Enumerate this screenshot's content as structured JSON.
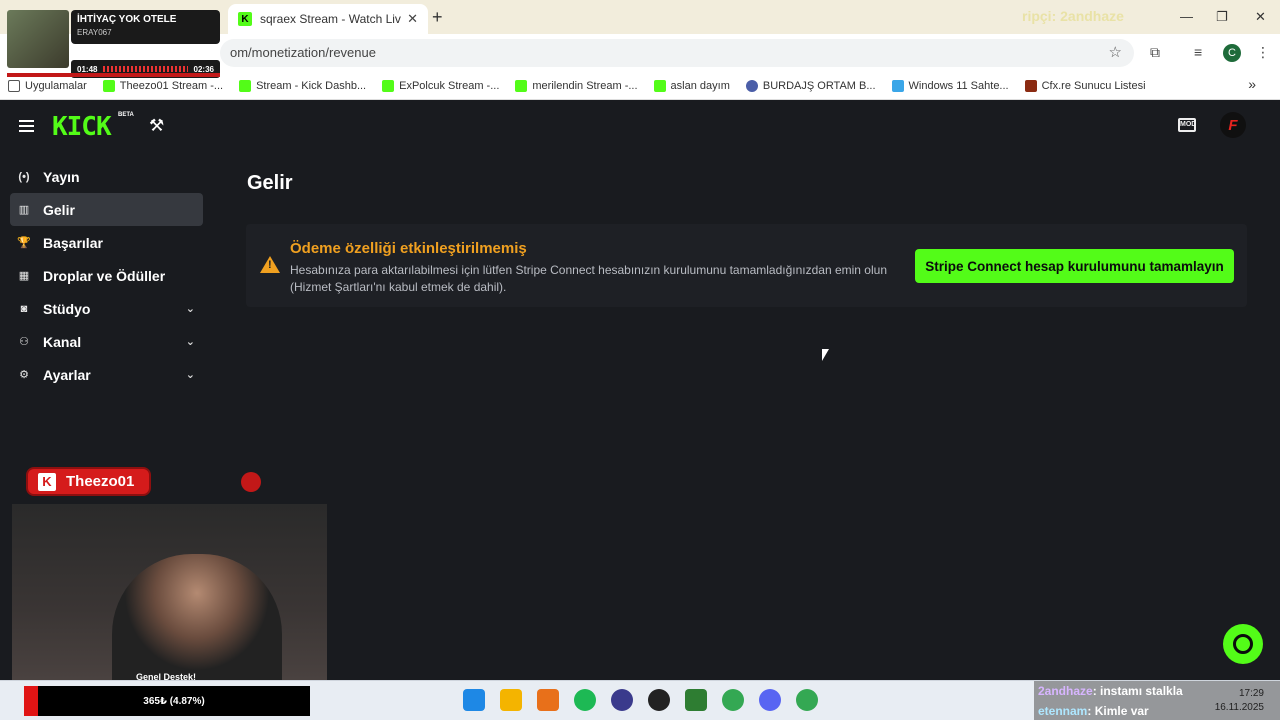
{
  "browser": {
    "active_tab_title": "sqraex Stream - Watch Live on",
    "top_overlay_text": "ripçi: 2andhaze",
    "url_partial": "om/monetization/revenue",
    "bookmarks": [
      {
        "label": "Uygulamalar",
        "icon": "apps-grid-icon"
      },
      {
        "label": "Theezo01 Stream -...",
        "icon": "kick-icon"
      },
      {
        "label": "Stream - Kick Dashb...",
        "icon": "kick-icon"
      },
      {
        "label": "ExPolcuk Stream -...",
        "icon": "kick-icon"
      },
      {
        "label": "merilendin Stream -...",
        "icon": "kick-icon"
      },
      {
        "label": "aslan dayım",
        "icon": "kick-icon"
      },
      {
        "label": "BURDAJŞ ORTAM B...",
        "icon": "globe-icon"
      },
      {
        "label": "Windows 11 Sahte...",
        "icon": "windows-icon"
      },
      {
        "label": "Cfx.re Sunucu Listesi",
        "icon": "cfx-icon"
      }
    ],
    "profile_initial": "C"
  },
  "music": {
    "song": "İHTİYAÇ YOK OTELE",
    "artist": "ERAY067",
    "elapsed": "01:48",
    "total": "02:36"
  },
  "kick": {
    "logo": "KICK",
    "beta": "BETA",
    "nav": [
      {
        "label": "Yayın",
        "icon": "broadcast-icon",
        "active": false,
        "expandable": false
      },
      {
        "label": "Gelir",
        "icon": "chart-icon",
        "active": true,
        "expandable": false
      },
      {
        "label": "Başarılar",
        "icon": "trophy-icon",
        "active": false,
        "expandable": false
      },
      {
        "label": "Droplar ve Ödüller",
        "icon": "gift-icon",
        "active": false,
        "expandable": false
      },
      {
        "label": "Stüdyo",
        "icon": "studio-icon",
        "active": false,
        "expandable": true
      },
      {
        "label": "Kanal",
        "icon": "channel-icon",
        "active": false,
        "expandable": true
      },
      {
        "label": "Ayarlar",
        "icon": "gear-icon",
        "active": false,
        "expandable": true
      }
    ],
    "page_title": "Gelir",
    "alert": {
      "title": "Ödeme özelliği etkinleştirilmemiş",
      "text": "Hesabınıza para aktarılabilmesi için lütfen Stripe Connect hesabınızın kurulumunu tamamladığınızdan emin olun (Hizmet Şartları'nı kabul etmek de dahil).",
      "button": "Stripe Connect hesap kurulumunu tamamlayın"
    }
  },
  "stream_overlay": {
    "streamer": "Theezo01",
    "cam_caption": "Genel Destek!",
    "goal_text": "365₺ (4.87%)"
  },
  "chat": [
    {
      "user": "2andhaze",
      "message": ": instamı stalkla"
    },
    {
      "user": "etennam",
      "message": ": Kimle var"
    }
  ],
  "clock": {
    "time": "17:29",
    "date": "16.11.2025"
  },
  "colors": {
    "kick_green": "#53fc18",
    "warning": "#f0a020",
    "bg": "#191b1f"
  }
}
